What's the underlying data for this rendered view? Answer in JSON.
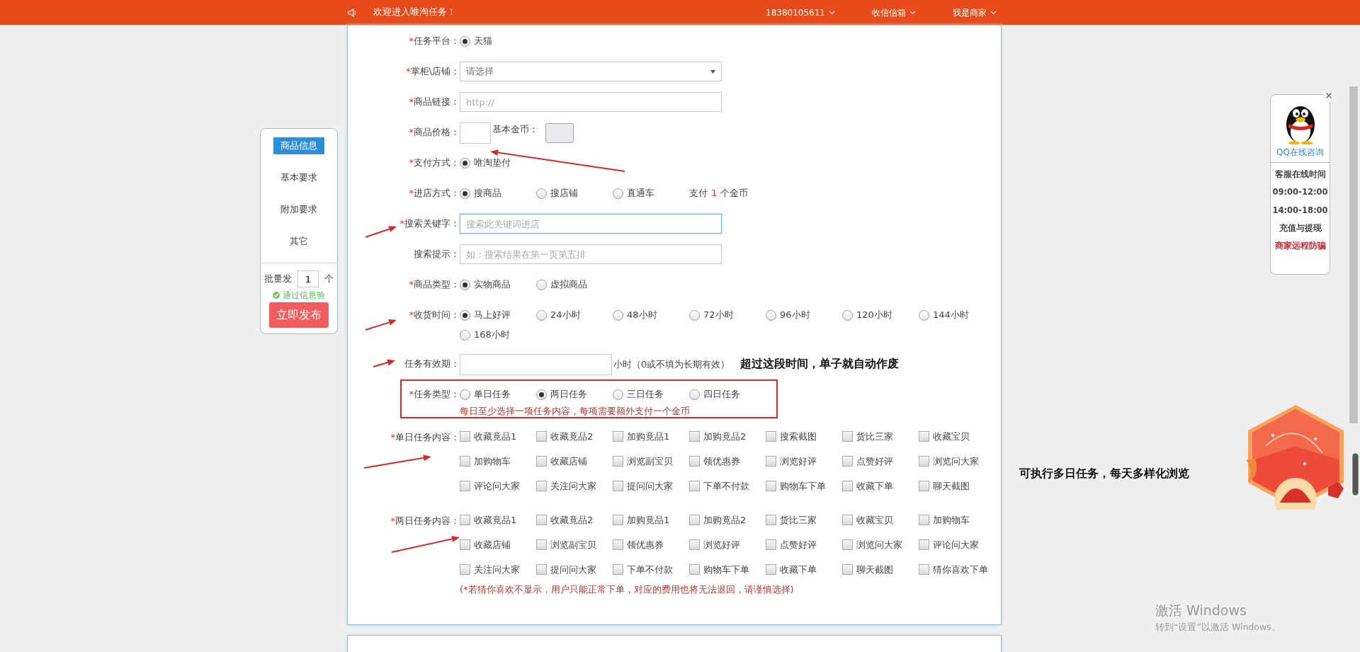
{
  "top_bar": {
    "welcome": "欢迎进入唯淘任务！",
    "menus": [
      {
        "label": "18380105611"
      },
      {
        "label": "收信信箱"
      },
      {
        "label": "我是商家"
      }
    ]
  },
  "side_nav": {
    "items": [
      {
        "label": "商品信息",
        "selected": true
      },
      {
        "label": "基本要求",
        "selected": false
      },
      {
        "label": "附加要求",
        "selected": false
      },
      {
        "label": "其它",
        "selected": false
      }
    ],
    "batch_label": "批量发",
    "batch_value": "1",
    "batch_unit": "个",
    "verified": "通过信息验",
    "publish_button": "立即发布"
  },
  "form": {
    "rows": [
      {
        "kind": "radio",
        "mark": "*",
        "label": "任务平台：",
        "options": [
          {
            "label": "天猫",
            "selected": true
          }
        ]
      },
      {
        "kind": "select",
        "mark": "*",
        "label": "掌柜\\店铺：",
        "value": "请选择"
      },
      {
        "kind": "input",
        "mark": "*",
        "label": "商品链接：",
        "placeholder": "http://"
      },
      {
        "kind": "price",
        "mark": "*",
        "label": "商品价格：",
        "coin_label": "基本金币："
      },
      {
        "kind": "radio",
        "mark": "*",
        "label": "支付方式：",
        "options": [
          {
            "label": "唯淘垫付",
            "selected": true
          }
        ]
      },
      {
        "kind": "radio",
        "mark": "*",
        "label": "进店方式：",
        "options": [
          {
            "label": "搜商品",
            "selected": true
          },
          {
            "label": "搜店铺",
            "selected": false
          },
          {
            "label": "直通车",
            "selected": false
          }
        ],
        "fee": {
          "before": "支付",
          "count": "1",
          "after": "个金币"
        }
      },
      {
        "kind": "input",
        "mark": "*",
        "label": "搜索关键字：",
        "placeholder": "搜索此关键词进店",
        "focused": true
      },
      {
        "kind": "input",
        "label": "搜索提示：",
        "placeholder": "如：搜索结果在第一页第五排",
        "focused": false
      },
      {
        "kind": "radio",
        "mark": "*",
        "label": "商品类型：",
        "options": [
          {
            "label": "实物商品",
            "selected": true
          },
          {
            "label": "虚拟商品",
            "selected": false
          }
        ]
      },
      {
        "kind": "radio",
        "mark": "*",
        "label": "收货时间：",
        "options": [
          {
            "label": "马上好评",
            "selected": true
          },
          {
            "label": "24小时",
            "selected": false
          },
          {
            "label": "48小时",
            "selected": false
          },
          {
            "label": "72小时",
            "selected": false
          },
          {
            "label": "96小时",
            "selected": false
          },
          {
            "label": "120小时",
            "selected": false
          },
          {
            "label": "144小时",
            "selected": false
          },
          {
            "label": "168小时",
            "selected": false
          }
        ]
      },
      {
        "kind": "duration",
        "label": "任务有效期：",
        "unit": "小时（0或不填为长期有效）"
      },
      {
        "kind": "radio",
        "mark": "*",
        "label": "任务类型：",
        "options": [
          {
            "label": "单日任务",
            "selected": false
          },
          {
            "label": "两日任务",
            "selected": true
          },
          {
            "label": "三日任务",
            "selected": false
          },
          {
            "label": "四日任务",
            "selected": false
          }
        ],
        "note": "每日至少选择一项任务内容，每项需要额外支付一个金币"
      },
      {
        "kind": "checkboxes",
        "mark": "*",
        "label": "单日任务内容：",
        "options": [
          {
            "label": "收藏竟品1",
            "checked": false
          },
          {
            "label": "收藏竟品2",
            "checked": false
          },
          {
            "label": "加购竟品1",
            "checked": false
          },
          {
            "label": "加购竟品2",
            "checked": false
          },
          {
            "label": "搜索截图",
            "checked": false
          },
          {
            "label": "货比三家",
            "checked": false
          },
          {
            "label": "收藏宝贝",
            "checked": false
          },
          {
            "label": "加购物车",
            "checked": false
          },
          {
            "label": "收藏店铺",
            "checked": false
          },
          {
            "label": "浏览副宝贝",
            "checked": false
          },
          {
            "label": "领优惠券",
            "checked": false
          },
          {
            "label": "浏览好评",
            "checked": false
          },
          {
            "label": "点赞好评",
            "checked": false
          },
          {
            "label": "浏览问大家",
            "checked": false
          },
          {
            "label": "评论问大家",
            "checked": false
          },
          {
            "label": "关注问大家",
            "checked": false
          },
          {
            "label": "提问问大家",
            "checked": false
          },
          {
            "label": "下单不付款",
            "checked": false
          },
          {
            "label": "购物车下单",
            "checked": false
          },
          {
            "label": "收藏下单",
            "checked": false
          },
          {
            "label": "聊天截图",
            "checked": false
          }
        ]
      },
      {
        "kind": "checkboxes",
        "mark": "*",
        "label": "两日任务内容：",
        "options": [
          {
            "label": "收藏竟品1",
            "checked": false
          },
          {
            "label": "收藏竟品2",
            "checked": false
          },
          {
            "label": "加购竟品1",
            "checked": false
          },
          {
            "label": "加购竟品2",
            "checked": false
          },
          {
            "label": "货比三家",
            "checked": false
          },
          {
            "label": "收藏宝贝",
            "checked": false
          },
          {
            "label": "加购物车",
            "checked": false
          },
          {
            "label": "收藏店铺",
            "checked": false
          },
          {
            "label": "浏览副宝贝",
            "checked": false
          },
          {
            "label": "领优惠券",
            "checked": false
          },
          {
            "label": "浏览好评",
            "checked": false
          },
          {
            "label": "点赞好评",
            "checked": false
          },
          {
            "label": "浏览问大家",
            "checked": false
          },
          {
            "label": "评论问大家",
            "checked": false
          },
          {
            "label": "关注问大家",
            "checked": false
          },
          {
            "label": "提问问大家",
            "checked": false
          },
          {
            "label": "下单不付款",
            "checked": false
          },
          {
            "label": "购物车下单",
            "checked": false
          },
          {
            "label": "收藏下单",
            "checked": false
          },
          {
            "label": "聊天截图",
            "checked": false
          },
          {
            "label": "猜你喜欢下单",
            "checked": false
          }
        ],
        "note": "(*若猜你喜欢不显示，用户只能正常下单，对应的费用也将无法退回，请谨慎选择)"
      }
    ]
  },
  "qq_widget": {
    "title": "QQ在线咨询",
    "lines": [
      {
        "text": "客服在线时间",
        "kind": "plain"
      },
      {
        "text": "09:00-12:00",
        "kind": "plain"
      },
      {
        "text": "14:00-18:00",
        "kind": "plain"
      },
      {
        "text": "充值与提现",
        "kind": "plain"
      },
      {
        "text": "商家远程防骗",
        "kind": "alert"
      }
    ]
  },
  "annotations": [
    {
      "text": "超过这段时间，单子就自动作废"
    },
    {
      "text": "可执行多日任务，每天多样化浏览"
    }
  ],
  "windows_notice": {
    "title": "激活 Windows",
    "subtitle": "转到“设置”以激活 Windows。"
  }
}
